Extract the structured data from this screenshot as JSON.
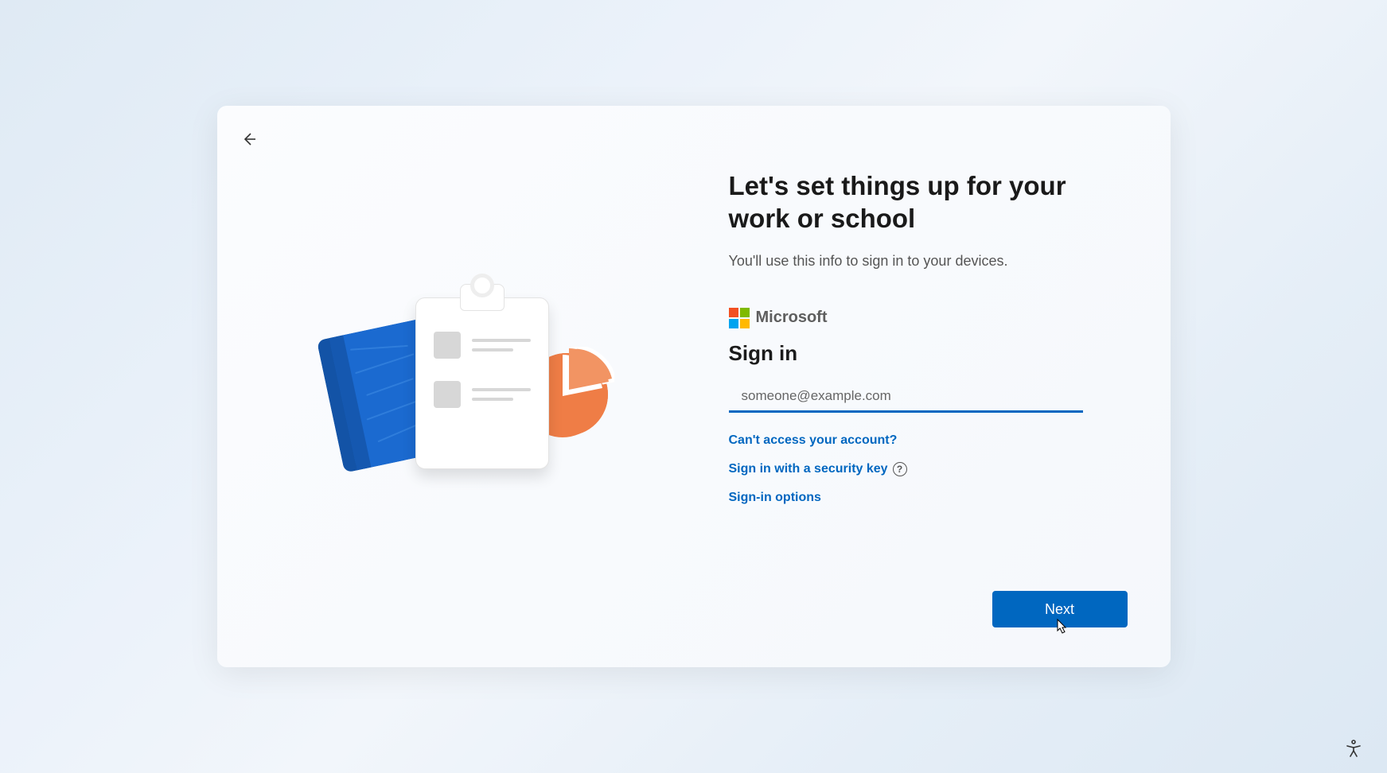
{
  "header": {
    "title": "Let's set things up for your work or school",
    "subtitle": "You'll use this info to sign in to your devices."
  },
  "brand": {
    "name": "Microsoft",
    "colors": {
      "red": "#f25022",
      "green": "#7fba00",
      "blue": "#00a4ef",
      "yellow": "#ffb900"
    }
  },
  "signin": {
    "heading": "Sign in",
    "email_placeholder": "someone@example.com",
    "email_value": "",
    "links": {
      "cant_access": "Can't access your account?",
      "security_key": "Sign in with a security key",
      "options": "Sign-in options"
    }
  },
  "buttons": {
    "next": "Next"
  },
  "colors": {
    "accent": "#0067c0",
    "link": "#0067c0"
  }
}
